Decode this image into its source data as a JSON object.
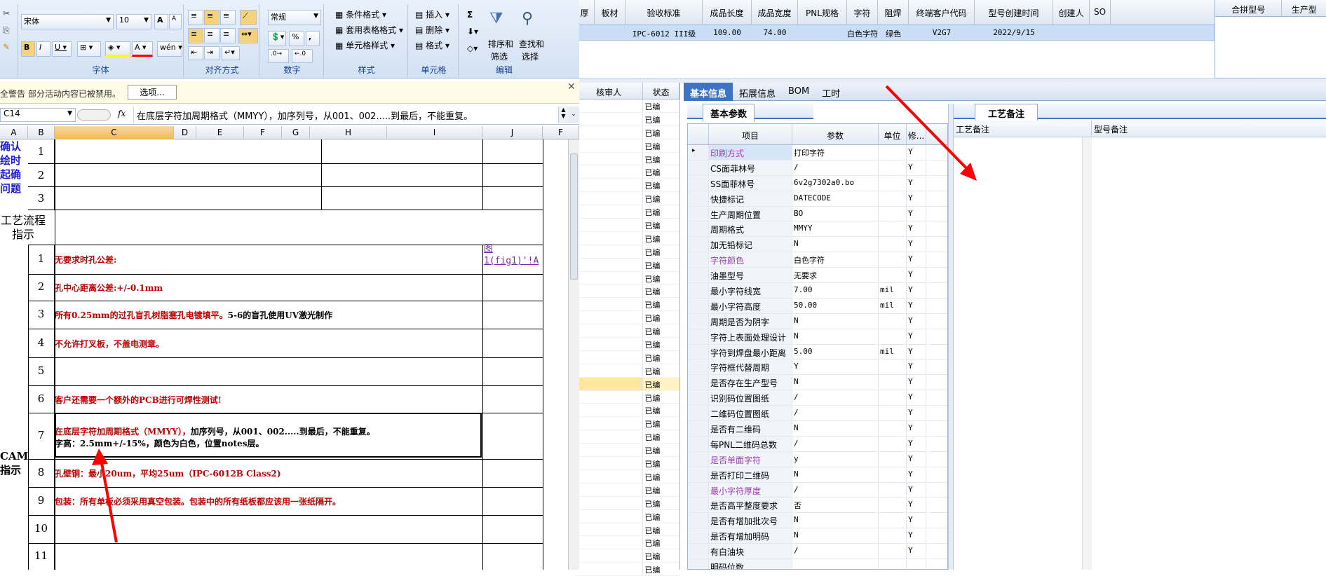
{
  "excel": {
    "font_name": "宋体",
    "font_size": "10",
    "number_format": "常规",
    "percent_symbol": "%",
    "comma_symbol": ",",
    "groups": {
      "font": "字体",
      "alignment": "对齐方式",
      "number": "数字",
      "styles": "样式",
      "cells": "单元格",
      "editing": "编辑"
    },
    "styles_items": [
      "条件格式",
      "套用表格格式",
      "单元格样式"
    ],
    "cells_items": [
      "插入",
      "删除",
      "格式"
    ],
    "editing_items": {
      "sort_filter": [
        "排序和",
        "筛选"
      ],
      "find_select": [
        "查找和",
        "选择"
      ],
      "sigma": "Σ"
    },
    "security_bar": {
      "warning": "全警告",
      "message": "部分活动内容已被禁用。",
      "options_button": "选项..."
    },
    "name_box": "C14",
    "fx": "fx",
    "formula": "在底层字符加周期格式（MMYY），加序列号，从001、002.....到最后，不能重复。",
    "columns": [
      "A",
      "B",
      "C",
      "D",
      "E",
      "F",
      "G",
      "H",
      "I",
      "J",
      "F"
    ],
    "left_texts": {
      "confirm": [
        "确认",
        "绘时",
        "起确",
        "问题"
      ],
      "process": [
        "工艺流程",
        "指示"
      ],
      "cam": [
        "CAM",
        "指示"
      ]
    },
    "top_rows": [
      "1",
      "2",
      "3"
    ],
    "rows": [
      {
        "n": "1",
        "text": "无要求时孔公差:"
      },
      {
        "n": "2",
        "text": "孔中心距离公差:+/-0.1mm"
      },
      {
        "n": "3",
        "text": "所有0.25mm的过孔盲孔树脂塞孔电镀填平。",
        "text2": "5-6的盲孔使用UV激光制作"
      },
      {
        "n": "4",
        "text": "不允许打叉板，不盖电测章。"
      },
      {
        "n": "5",
        "text": ""
      },
      {
        "n": "6",
        "text": "客户还需要一个额外的PCB进行可焊性测试!"
      },
      {
        "n": "7",
        "text": "在底层字符加周期格式（MMYY），",
        "text2": "加序列号，从001、002.....到最后，不能重复。",
        "text3": "字高：2.5mm+/-15%，颜色为白色，位置notes层。"
      },
      {
        "n": "8",
        "text": "孔壁铜：最小20um，平均25um（IPC-6012B Class2)"
      },
      {
        "n": "9",
        "text": "包装：所有单板必须采用真空包装。包装中的所有纸板都应该用一张纸隔开。"
      },
      {
        "n": "10",
        "text": ""
      },
      {
        "n": "11",
        "text": ""
      }
    ],
    "link_text": [
      "图",
      "1(fig1)'!A"
    ]
  },
  "mis": {
    "top_headers": [
      "厚",
      "板材",
      "验收标准",
      "成品长度",
      "成品宽度",
      "PNL规格",
      "字符",
      "阻焊",
      "终端客户代码",
      "型号创建时间",
      "创建人",
      "SO"
    ],
    "top_values": [
      "",
      "",
      "IPC-6012 III级",
      "109.00",
      "74.00",
      "",
      "白色字符",
      "绿色",
      "V2G7",
      "2022/9/15",
      "",
      ""
    ],
    "right_headers": [
      "合拼型号",
      "生产型"
    ],
    "list_headers": [
      "核审人",
      "状态"
    ],
    "list_status": "已编",
    "tabs": [
      "基本信息",
      "拓展信息",
      "BOM",
      "工时"
    ],
    "param_tab": "基本参数",
    "param_headers": [
      "项目",
      "参数",
      "单位",
      "修..."
    ],
    "params": [
      {
        "name": "印刷方式",
        "value": "打印字符",
        "unit": "",
        "mod": "Y",
        "purple": true
      },
      {
        "name": "CS面菲林号",
        "value": "/",
        "unit": "",
        "mod": "Y"
      },
      {
        "name": "SS面菲林号",
        "value": "6v2g7302a0.bo",
        "unit": "",
        "mod": "Y"
      },
      {
        "name": "快捷标记",
        "value": "DATECODE",
        "unit": "",
        "mod": "Y"
      },
      {
        "name": "生产周期位置",
        "value": "BO",
        "unit": "",
        "mod": "Y"
      },
      {
        "name": "周期格式",
        "value": "MMYY",
        "unit": "",
        "mod": "Y"
      },
      {
        "name": "加无铅标记",
        "value": "N",
        "unit": "",
        "mod": "Y"
      },
      {
        "name": "字符颜色",
        "value": "白色字符",
        "unit": "",
        "mod": "Y",
        "purple": true
      },
      {
        "name": "油墨型号",
        "value": "无要求",
        "unit": "",
        "mod": "Y"
      },
      {
        "name": "最小字符线宽",
        "value": "7.00",
        "unit": "mil",
        "mod": "Y"
      },
      {
        "name": "最小字符高度",
        "value": "50.00",
        "unit": "mil",
        "mod": "Y"
      },
      {
        "name": "周期是否为阴字",
        "value": "N",
        "unit": "",
        "mod": "Y"
      },
      {
        "name": "字符上表面处理设计",
        "value": "N",
        "unit": "",
        "mod": "Y"
      },
      {
        "name": "字符到焊盘最小距离",
        "value": "5.00",
        "unit": "mil",
        "mod": "Y"
      },
      {
        "name": "字符框代替周期",
        "value": "Y",
        "unit": "",
        "mod": "Y"
      },
      {
        "name": "是否存在生产型号",
        "value": "N",
        "unit": "",
        "mod": "Y"
      },
      {
        "name": "识别码位置图纸",
        "value": "/",
        "unit": "",
        "mod": "Y"
      },
      {
        "name": "二维码位置图纸",
        "value": "/",
        "unit": "",
        "mod": "Y"
      },
      {
        "name": "是否有二维码",
        "value": "N",
        "unit": "",
        "mod": "Y"
      },
      {
        "name": "每PNL二维码总数",
        "value": "/",
        "unit": "",
        "mod": "Y"
      },
      {
        "name": "是否单面字符",
        "value": "y",
        "unit": "",
        "mod": "Y",
        "purple": true
      },
      {
        "name": "是否打印二维码",
        "value": "N",
        "unit": "",
        "mod": "Y"
      },
      {
        "name": "最小字符厚度",
        "value": "/",
        "unit": "",
        "mod": "Y",
        "purple": true
      },
      {
        "name": "是否高平整度要求",
        "value": "否",
        "unit": "",
        "mod": "Y"
      },
      {
        "name": "是否有增加批次号",
        "value": "N",
        "unit": "",
        "mod": "Y"
      },
      {
        "name": "是否有增加明码",
        "value": "N",
        "unit": "",
        "mod": "Y"
      },
      {
        "name": "有白油块",
        "value": "/",
        "unit": "",
        "mod": "Y"
      },
      {
        "name": "明码位数",
        "value": "",
        "unit": "",
        "mod": ""
      }
    ],
    "notes_tab": "工艺备注",
    "notes_headers": [
      "工艺备注",
      "型号备注"
    ]
  },
  "colors": {
    "arrow": "#ff0000",
    "tab_active": "#3d73c4",
    "red_text": "#c00000",
    "purple_text": "#9b3cb2"
  }
}
